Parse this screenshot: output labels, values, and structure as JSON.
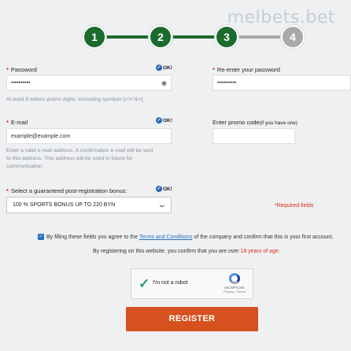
{
  "watermark": "melbets.bet",
  "steps": [
    "1",
    "2",
    "3",
    "4"
  ],
  "colors": {
    "step_active": "#1b6b2d",
    "step_inactive": "#a9a9a9",
    "accent_red": "#e02b1a",
    "register_button": "#d6511f",
    "link_blue": "#2d6fc1"
  },
  "form": {
    "required_mark": "*",
    "ok_label": "OK!",
    "password": {
      "label": "Password",
      "value": "••••••••••",
      "hint": "At least 8 letters and/or digits, excluding symbols [<>\\\"&+]"
    },
    "password_repeat": {
      "label": "Re-enter your password",
      "value": "••••••••••"
    },
    "email": {
      "label": "E-mail",
      "value": "example@example.com",
      "hint": "Enter a valid e-mail address. A confirmation e-mail will be sent to this address. This address will be used in future for communication."
    },
    "promo": {
      "label": "Enter promo code",
      "label_note": "(if you have one)",
      "value": ""
    },
    "bonus": {
      "label": "Select a guaranteed post-registration bonus:",
      "selected": "100 % SPORTS BONUS UP TO 220 BYN"
    },
    "required_note": "*Required fields",
    "agree": {
      "before": "By filling these fields you agree to the ",
      "link": "Terms and Conditions",
      "after": " of the company and confirm that this is your first account."
    },
    "age": {
      "before": "By registering on this website, you confirm that you are over ",
      "highlight": "18 years of age",
      "after": "."
    },
    "recaptcha": {
      "label": "I'm not a robot",
      "brand": "reCAPTCHA",
      "terms": "Privacy - Terms"
    },
    "register_label": "REGISTER"
  }
}
